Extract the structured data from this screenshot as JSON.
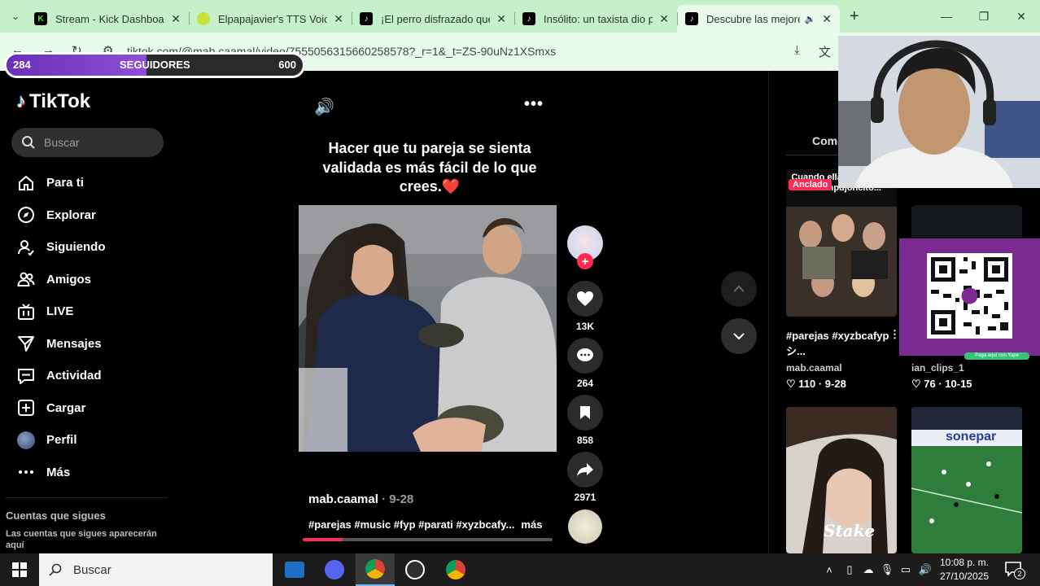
{
  "browser": {
    "tabs": [
      {
        "title": "Stream - Kick Dashboard",
        "icon": "kick-icon",
        "color": "#53fc18"
      },
      {
        "title": "Elpapajavier's TTS Voice",
        "icon": "tts-icon",
        "color": "#c8e23a"
      },
      {
        "title": "¡El perro disfrazado que",
        "icon": "tiktok-icon",
        "color": "#000000"
      },
      {
        "title": "Insólito: un taxista dio po",
        "icon": "tiktok-icon",
        "color": "#000000"
      },
      {
        "title": "Descubre las mejores",
        "icon": "tiktok-icon",
        "color": "#000000",
        "active": true
      }
    ],
    "url": "tiktok.com/@mab.caamal/video/7555056315660258578?_r=1&_t=ZS-90uNz1XSmxs"
  },
  "follow_goal": {
    "current": "284",
    "label": "SEGUIDORES",
    "goal": "600",
    "progress": 0.473
  },
  "sidebar": {
    "brand": "TikTok",
    "search_placeholder": "Buscar",
    "items": [
      {
        "label": "Para ti",
        "icon": "home-icon"
      },
      {
        "label": "Explorar",
        "icon": "compass-icon"
      },
      {
        "label": "Siguiendo",
        "icon": "following-icon"
      },
      {
        "label": "Amigos",
        "icon": "friends-icon"
      },
      {
        "label": "LIVE",
        "icon": "live-icon"
      },
      {
        "label": "Mensajes",
        "icon": "messages-icon"
      },
      {
        "label": "Actividad",
        "icon": "activity-icon"
      },
      {
        "label": "Cargar",
        "icon": "upload-icon"
      },
      {
        "label": "Perfil",
        "icon": "profile-avatar"
      },
      {
        "label": "Más",
        "icon": "more-icon"
      }
    ],
    "follows_heading": "Cuentas que sigues",
    "follows_text": "Las cuentas que sigues aparecerán aquí"
  },
  "video": {
    "caption": "Hacer que tu pareja se sienta validada es más fácil de lo que crees.❤️",
    "author": "mab.caamal",
    "date": "· 9-28",
    "tags": "#parejas #music #fyp #parati #xyzbcafy...",
    "more": "más",
    "progress": 0.16,
    "likes": "13K",
    "comments": "264",
    "saves": "858",
    "shares": "2971"
  },
  "right_panel": {
    "tab": "Come",
    "pinned_label": "Anclado",
    "pinned_overlay": "Cuando ella... do y le da ese empujoncito...",
    "cards": [
      {
        "title": "#parejas #xyzbcafypシ...",
        "user": "mab.caamal",
        "stat": "♡ 110 · 9-28"
      },
      {
        "title": "",
        "user": "ian_clips_1",
        "stat": "♡ 76 · 10-15"
      }
    ],
    "qr_caption": "Paga aquí con Yape",
    "brand_overlay": "Stake",
    "sponsor_banner": "sonepar"
  },
  "taskbar": {
    "search_placeholder": "Buscar",
    "time": "10:08 p. m.",
    "date": "27/10/2025",
    "notifications": "2"
  }
}
